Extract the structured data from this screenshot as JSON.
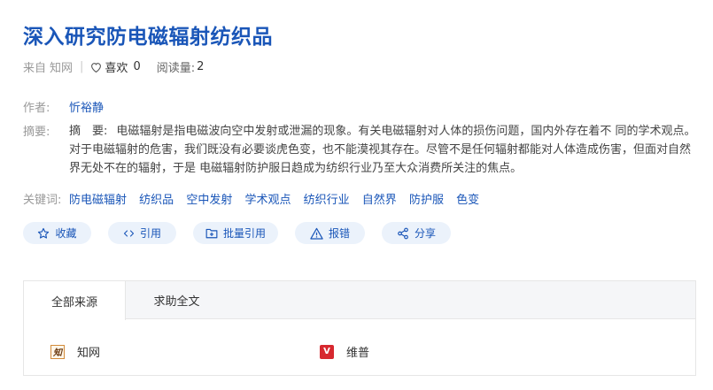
{
  "article": {
    "title": "深入研究防电磁辐射纺织品",
    "source_prefix": "来自",
    "source_name": "知网",
    "separator": "|",
    "likes_label": "喜欢",
    "likes_count": "0",
    "reads_label": "阅读量:",
    "reads_count": "2"
  },
  "author": {
    "label": "作者:",
    "value": "忻裕静"
  },
  "abstract": {
    "label": "摘要:",
    "lead": "摘　要:",
    "text": "电磁辐射是指电磁波向空中发射或泄漏的现象。有关电磁辐射对人体的损伤问题，国内外存在着不 同的学术观点。对于电磁辐射的危害，我们既没有必要谈虎色变，也不能漠视其存在。尽管不是任何辐射都能对人体造成伤害，但面对自然界无处不在的辐射，于是 电磁辐射防护服日趋成为纺织行业乃至大众消费所关注的焦点。"
  },
  "keywords": {
    "label": "关键词:",
    "items": [
      "防电磁辐射",
      "纺织品",
      "空中发射",
      "学术观点",
      "纺织行业",
      "自然界",
      "防护服",
      "色变"
    ]
  },
  "actions": {
    "collect": "收藏",
    "cite": "引用",
    "batch_cite": "批量引用",
    "report": "报错",
    "share": "分享"
  },
  "sources": {
    "tabs": [
      "全部来源",
      "求助全文"
    ],
    "items": [
      {
        "name": "知网",
        "icon": "cnki-logo-icon"
      },
      {
        "name": "维普",
        "icon": "vip-logo-icon"
      }
    ]
  },
  "colors": {
    "accent": "#1a56b8",
    "button_bg": "#ebf2fb"
  }
}
